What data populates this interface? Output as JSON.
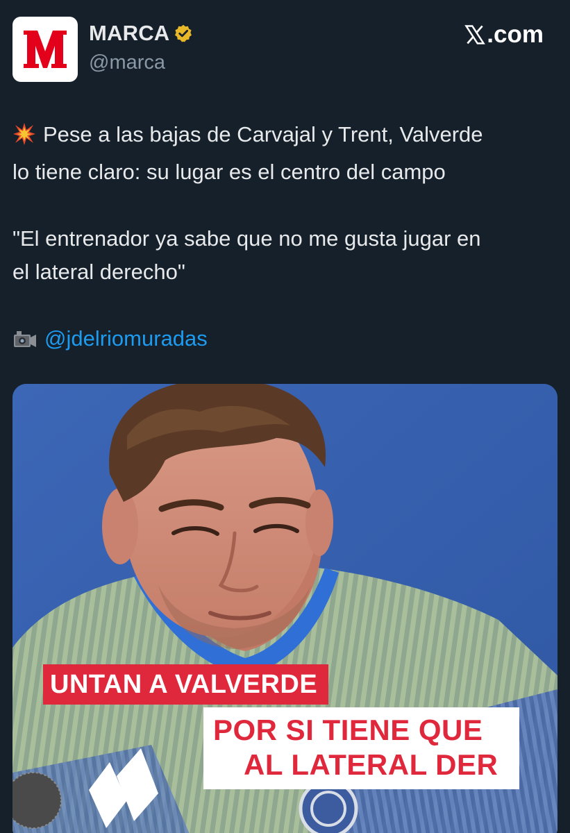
{
  "header": {
    "display_name": "MARCA",
    "handle": "@marca",
    "site": ".com",
    "avatar_icon": "marca-logo-icon",
    "verified_icon": "verified-badge-icon",
    "brand_color": "#e2001a",
    "verified_color": "#e8b829"
  },
  "tweet": {
    "line1": "Pese a las bajas de Carvajal y Trent, Valverde",
    "line2": "lo tiene claro: su lugar es el centro del campo",
    "quote_line1": "\"El entrenador ya sabe que no me gusta jugar en",
    "quote_line2": "el lateral derecho\"",
    "credit_mention": "@jdelriomuradas",
    "lead_emoji_icon": "collision-emoji-icon",
    "credit_emoji_icon": "video-camera-emoji-icon",
    "link_color": "#1d9bf0"
  },
  "media": {
    "caption_top": "UNTAN A VALVERDE",
    "caption_bottom_line1": "POR SI TIENE QUE",
    "caption_bottom_line2": "AL LATERAL DER",
    "caption_color": "#e0283d"
  }
}
